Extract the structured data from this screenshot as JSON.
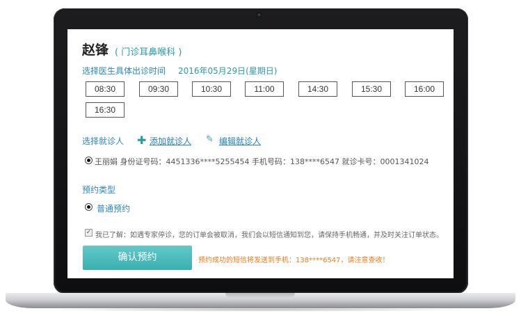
{
  "doctor": {
    "name": "赵锋",
    "department": "( 门诊耳鼻喉科 )"
  },
  "schedule": {
    "label": "选择医生具体出诊时间",
    "date": "2016年05月29日(星期日)",
    "slots": [
      "08:30",
      "09:30",
      "10:30",
      "11:00",
      "14:30",
      "15:30",
      "16:00",
      "16:30"
    ]
  },
  "patient_select": {
    "label": "选择就诊人",
    "add_label": "添加就诊人",
    "edit_label": "编辑就诊人",
    "patient": "王丽娟 身份证号码：4451336****5255454  手机号码：138****6547  就诊卡号：0001341024"
  },
  "appointment_type": {
    "label": "预约类型",
    "option": "普通预约"
  },
  "agreement": {
    "text": "我已了解：如遇专家停诊，您的订单会被取消，我们会以短信通知到您，请保持手机畅通，并及时关注订单状态。"
  },
  "actions": {
    "confirm_label": "确认预约",
    "sms_notice": "预约成功的短信将发送到手机：138****6547，请注意查收！"
  },
  "colors": {
    "accent": "#2a9ba5",
    "link": "#1f7fc0",
    "button": "#3aafb0",
    "warning": "#f07a1a"
  },
  "icons": {
    "add": "plus-icon",
    "edit": "pencil-icon",
    "radio": "radio-selected-icon",
    "check": "checkbox-checked-icon"
  }
}
